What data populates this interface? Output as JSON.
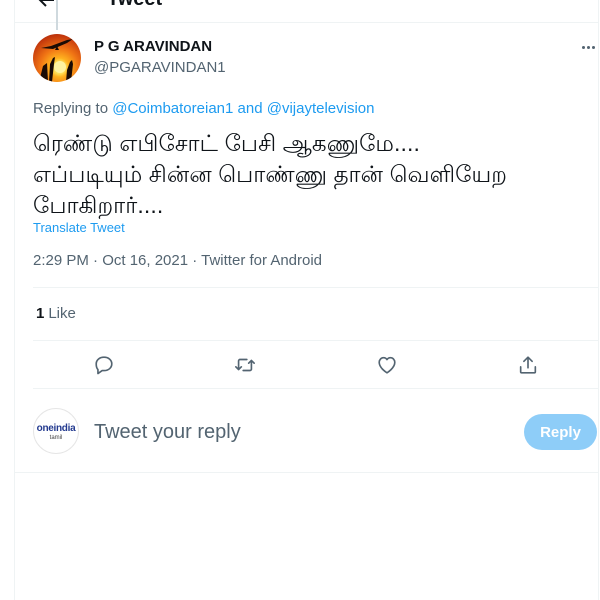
{
  "header": {
    "title": "Tweet"
  },
  "author": {
    "name": "P G ARAVINDAN",
    "handle": "@PGARAVINDAN1",
    "avatar_icon": "sunset-bird-avatar"
  },
  "replying": {
    "prefix": "Replying to",
    "mention_1": "@Coimbatoreian1",
    "conjunction": "and",
    "mention_2": "@vijaytelevision"
  },
  "tweet": {
    "text": "ரெண்டு எபிசோட் பேசி ஆகணுமே....\nஎப்படியும் சின்ன பொண்ணு தான் வெளியேற\nபோகிறார்....",
    "translate_label": "Translate Tweet",
    "timestamp": "2:29 PM · Oct 16, 2021 · Twitter for Android"
  },
  "stats": {
    "like_count": "1",
    "like_label": "Like"
  },
  "actions": [
    {
      "name": "reply",
      "icon": "comment-icon"
    },
    {
      "name": "retweet",
      "icon": "retweet-icon"
    },
    {
      "name": "like",
      "icon": "heart-icon"
    },
    {
      "name": "share",
      "icon": "share-icon"
    }
  ],
  "composer": {
    "placeholder": "Tweet your reply",
    "reply_label": "Reply",
    "logo_text_main": "oneindia",
    "logo_text_sub": "tamil"
  },
  "colors": {
    "accent": "#1d9bf0",
    "reply_button": "#8ecdf8",
    "muted": "#536471"
  }
}
